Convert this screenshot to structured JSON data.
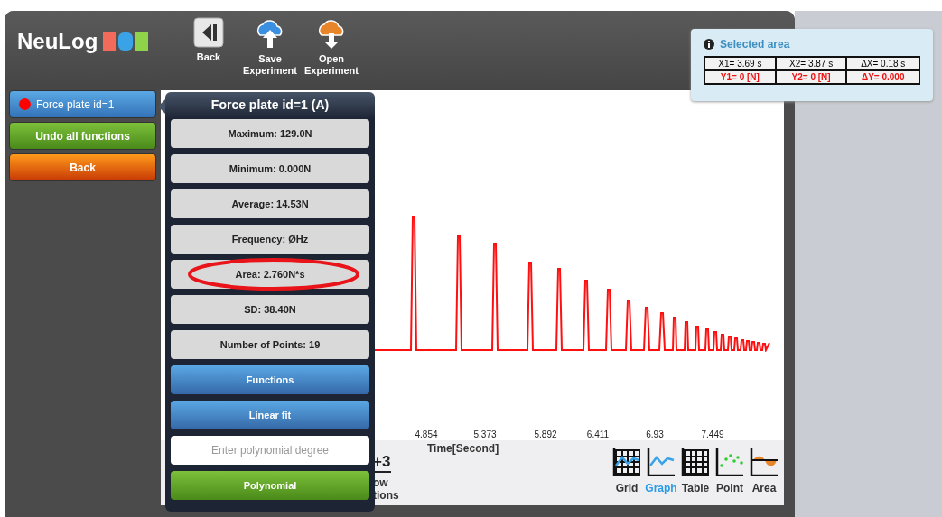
{
  "app": {
    "logo": "NeuLog"
  },
  "toolbar": [
    {
      "label": "Back",
      "kind": "back"
    },
    {
      "label": "Save Experiment",
      "kind": "save"
    },
    {
      "label": "Open Experiment",
      "kind": "open"
    }
  ],
  "sidebar": {
    "items": [
      {
        "label": "Force plate id=1",
        "kind": "sensor"
      },
      {
        "label": "Undo all functions",
        "kind": "green"
      },
      {
        "label": "Back",
        "kind": "orange"
      }
    ]
  },
  "graph": {
    "x_ticks": [
      "4.854",
      "5.373",
      "5.892",
      "6.411",
      "6.93",
      "7.449"
    ],
    "x_axis_title": "Time[Second]"
  },
  "bottom_toolbar": {
    "partial_tool": {
      "icon_text": "+3",
      "label_lines": [
        "ow",
        "tions"
      ]
    },
    "views": [
      {
        "label": "Grid",
        "kind": "grid",
        "selected": false
      },
      {
        "label": "Graph",
        "kind": "graph",
        "selected": true
      },
      {
        "label": "Table",
        "kind": "table",
        "selected": false
      },
      {
        "label": "Point",
        "kind": "point",
        "selected": false
      },
      {
        "label": "Area",
        "kind": "area",
        "selected": false
      }
    ]
  },
  "popup": {
    "title": "Force plate id=1 (A)",
    "stats": [
      {
        "label": "Maximum: 129.0N",
        "highlighted": false
      },
      {
        "label": "Minimum: 0.000N",
        "highlighted": false
      },
      {
        "label": "Average: 14.53N",
        "highlighted": false
      },
      {
        "label": "Frequency: ØHz",
        "highlighted": false
      },
      {
        "label": "Area: 2.760N*s",
        "highlighted": true
      },
      {
        "label": "SD: 38.40N",
        "highlighted": false
      },
      {
        "label": "Number of Points: 19",
        "highlighted": false
      }
    ],
    "actions": [
      {
        "label": "Functions",
        "kind": "blue"
      },
      {
        "label": "Linear fit",
        "kind": "blue"
      },
      {
        "kind": "input",
        "placeholder": "Enter polynomial degree"
      },
      {
        "label": "Polynomial",
        "kind": "green"
      }
    ]
  },
  "selected_area": {
    "title": "Selected area",
    "rows": [
      {
        "kind": "x",
        "cells": [
          "X1= 3.69 s",
          "X2= 3.87 s",
          "ΔX= 0.18 s"
        ]
      },
      {
        "kind": "y",
        "cells": [
          "Y1= 0 [N]",
          "Y2= 0 [N]",
          "ΔY= 0.000"
        ]
      }
    ]
  }
}
